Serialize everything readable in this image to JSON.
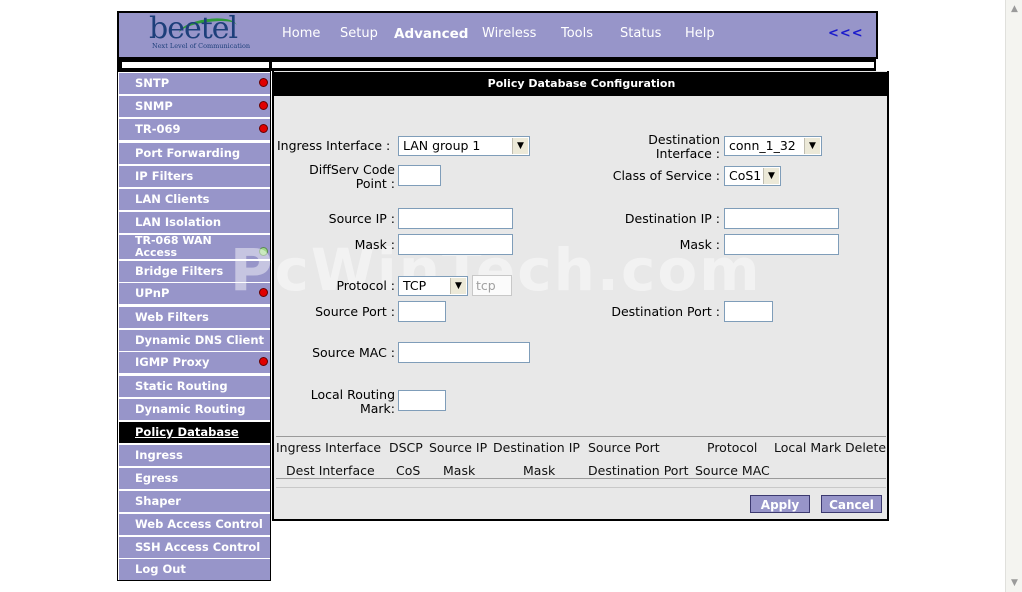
{
  "brand": {
    "logo_text": "beetel",
    "tagline": "Next Level of Communication"
  },
  "nav": [
    {
      "label": "Home",
      "active": false
    },
    {
      "label": "Setup",
      "active": false
    },
    {
      "label": "Advanced",
      "active": true
    },
    {
      "label": "Wireless",
      "active": false
    },
    {
      "label": "Tools",
      "active": false
    },
    {
      "label": "Status",
      "active": false
    },
    {
      "label": "Help",
      "active": false
    }
  ],
  "nav_back": "<<<",
  "sidebar": {
    "items": [
      {
        "label": "SNTP",
        "status": "red"
      },
      {
        "label": "SNMP",
        "status": "red"
      },
      {
        "label": "TR-069",
        "status": "red"
      },
      {
        "label": "Port Forwarding",
        "status": ""
      },
      {
        "label": "IP Filters",
        "status": ""
      },
      {
        "label": "LAN Clients",
        "status": ""
      },
      {
        "label": "LAN Isolation",
        "status": ""
      },
      {
        "label": "TR-068 WAN Access",
        "status": "green"
      },
      {
        "label": "Bridge Filters",
        "status": ""
      },
      {
        "label": "UPnP",
        "status": "red"
      },
      {
        "label": "Web Filters",
        "status": ""
      },
      {
        "label": "Dynamic DNS Client",
        "status": ""
      },
      {
        "label": "IGMP Proxy",
        "status": "red"
      },
      {
        "label": "Static Routing",
        "status": ""
      },
      {
        "label": "Dynamic Routing",
        "status": ""
      },
      {
        "label": "Policy Database",
        "status": "",
        "selected": true
      },
      {
        "label": "Ingress",
        "status": ""
      },
      {
        "label": "Egress",
        "status": ""
      },
      {
        "label": "Shaper",
        "status": ""
      },
      {
        "label": "Web Access Control",
        "status": ""
      },
      {
        "label": "SSH Access Control",
        "status": ""
      },
      {
        "label": "Log Out",
        "status": ""
      }
    ]
  },
  "panel": {
    "title": "Policy Database Configuration",
    "form": {
      "ingress_interface": {
        "label": "Ingress Interface :",
        "value": "LAN group 1"
      },
      "destination_interface": {
        "label_1": "Destination",
        "label_2": "Interface :",
        "value": "conn_1_32"
      },
      "diffserv": {
        "label_1": "DiffServ Code",
        "label_2": "Point :",
        "value": ""
      },
      "class_of_service": {
        "label": "Class of Service :",
        "value": "CoS1"
      },
      "source_ip": {
        "label": "Source IP :",
        "value": ""
      },
      "destination_ip": {
        "label": "Destination IP :",
        "value": ""
      },
      "source_mask": {
        "label": "Mask :",
        "value": ""
      },
      "dest_mask": {
        "label": "Mask :",
        "value": ""
      },
      "protocol": {
        "label": "Protocol :",
        "value": "TCP",
        "text_value": "tcp"
      },
      "source_port": {
        "label": "Source Port :",
        "value": ""
      },
      "destination_port": {
        "label": "Destination Port :",
        "value": ""
      },
      "source_mac": {
        "label": "Source MAC :",
        "value": ""
      },
      "local_routing_mark": {
        "label_1": "Local Routing",
        "label_2": "Mark:",
        "value": ""
      }
    },
    "table": {
      "header_row1": [
        "Ingress Interface",
        "DSCP",
        "Source IP",
        "Destination IP",
        "Source Port",
        "Protocol",
        "Local Mark",
        "Delete"
      ],
      "header_row2": [
        "Dest Interface",
        "CoS",
        "Mask",
        "Mask",
        "Destination Port",
        "Source MAC"
      ]
    },
    "buttons": {
      "apply": "Apply",
      "cancel": "Cancel"
    }
  },
  "watermark": "PcWinTech.com"
}
